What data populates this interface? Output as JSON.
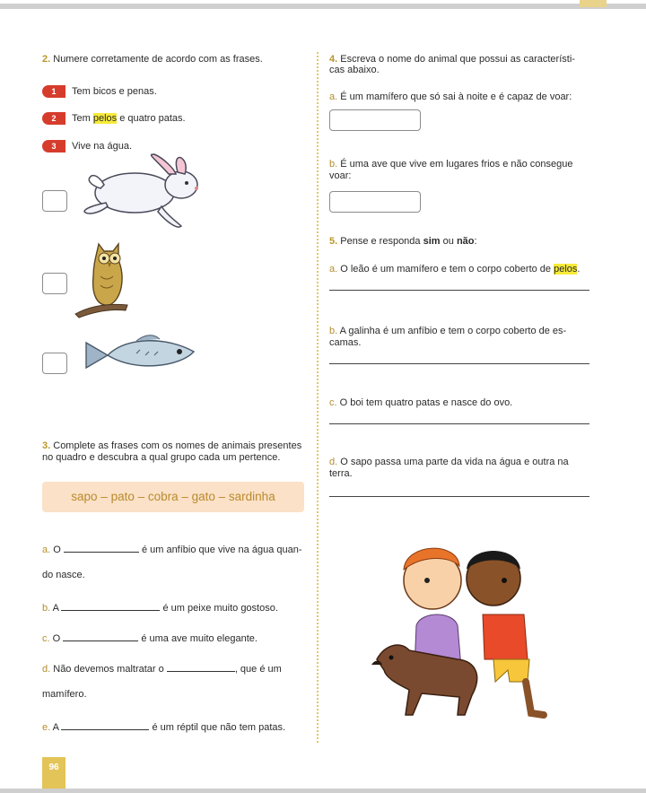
{
  "page": {
    "number": "96"
  },
  "q2": {
    "num": "2.",
    "prompt": "Numere corretamente de acordo com as frases.",
    "items": [
      {
        "badge": "1",
        "text": "Tem bicos e penas."
      },
      {
        "badge": "2",
        "before": "Tem ",
        "highlight": "pelos",
        "after": " e quatro patas."
      },
      {
        "badge": "3",
        "text": "Vive na água."
      }
    ],
    "animals": [
      "rabbit",
      "owl",
      "fish"
    ]
  },
  "q3": {
    "num": "3.",
    "prompt_l1": "Complete as frases com os nomes de animais presentes",
    "prompt_l2": "no quadro e descubra a qual grupo cada um pertence.",
    "word_bank": "sapo – pato – cobra – gato – sardinha",
    "items": {
      "a": {
        "letter": "a.",
        "pre": "O",
        "post": "é um anfíbio que vive na água quan-",
        "cont": "do nasce."
      },
      "b": {
        "letter": "b.",
        "pre": "A",
        "post": "é um peixe muito gostoso."
      },
      "c": {
        "letter": "c.",
        "pre": "O",
        "post": "é uma ave muito elegante."
      },
      "d": {
        "letter": "d.",
        "pre": "Não devemos maltratar o",
        "post": ", que é um",
        "cont": "mamífero."
      },
      "e": {
        "letter": "e.",
        "pre": "A",
        "post": "é um réptil que não tem patas."
      }
    }
  },
  "q4": {
    "num": "4.",
    "prompt_l1": "Escreva o nome do animal que possui as característi-",
    "prompt_l2": "cas abaixo.",
    "a": {
      "letter": "a.",
      "text": "É um mamífero que só sai à noite e é capaz de voar:"
    },
    "b": {
      "letter": "b.",
      "l1": "É uma ave que vive em lugares frios e não consegue",
      "l2": "voar:"
    }
  },
  "q5": {
    "num": "5.",
    "prompt_pre": "Pense e responda ",
    "sim": "sim",
    "ou": " ou ",
    "nao": "não",
    "colon": ":",
    "a": {
      "letter": "a.",
      "pre": "O leão é um mamífero e tem o corpo coberto de ",
      "highlight": "pelos",
      "post": "."
    },
    "b": {
      "letter": "b.",
      "l1": "A galinha é um anfíbio e tem o corpo coberto de es-",
      "l2": "camas."
    },
    "c": {
      "letter": "c.",
      "text": "O boi tem quatro patas e nasce do ovo."
    },
    "d": {
      "letter": "d.",
      "l1": "O sapo passa uma parte da vida na água e outra na",
      "l2": "terra."
    }
  },
  "colors": {
    "badge": "#d63c2c",
    "number": "#b9962a",
    "highlight": "#f7ea3a",
    "word_bank_bg": "#fbe1c7",
    "word_bank_text": "#b98b2e"
  }
}
